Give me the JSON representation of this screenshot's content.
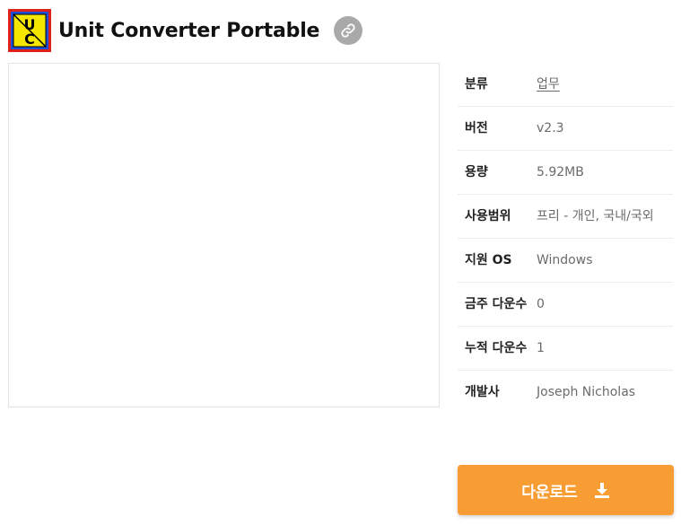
{
  "header": {
    "logo_letters": [
      "U",
      "C"
    ],
    "title": "Unit Converter Portable",
    "link_icon": "link-icon"
  },
  "info": {
    "rows": [
      {
        "label": "분류",
        "value": "업무",
        "is_link": true
      },
      {
        "label": "버전",
        "value": "v2.3"
      },
      {
        "label": "용량",
        "value": "5.92MB"
      },
      {
        "label": "사용범위",
        "value": "프리 - 개인, 국내/국외"
      },
      {
        "label": "지원 OS",
        "value": "Windows"
      },
      {
        "label": "금주 다운수",
        "value": "0"
      },
      {
        "label": "누적 다운수",
        "value": "1"
      },
      {
        "label": "개발사",
        "value": "Joseph Nicholas"
      }
    ]
  },
  "download": {
    "label": "다운로드",
    "icon": "download-icon"
  },
  "colors": {
    "accent": "#f89c34",
    "link_button_bg": "#a9a9a9",
    "logo_yellow": "#f5e600",
    "logo_blue": "#1e4fd8",
    "logo_red": "#e0201a"
  }
}
